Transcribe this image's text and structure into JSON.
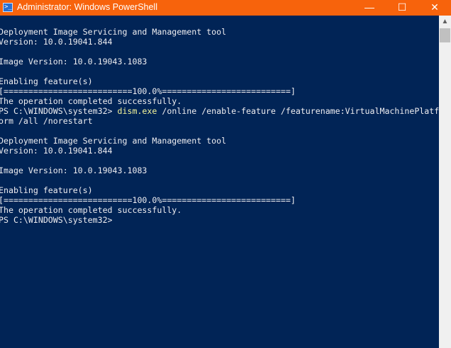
{
  "window": {
    "title": "Administrator: Windows PowerShell",
    "icon": "powershell-icon",
    "minimize": "—",
    "maximize": "☐",
    "close": "✕"
  },
  "console": {
    "lines": [
      {
        "text": "Deployment Image Servicing and Management tool"
      },
      {
        "text": "Version: 10.0.19041.844"
      },
      {
        "text": ""
      },
      {
        "text": "Image Version: 10.0.19043.1083"
      },
      {
        "text": ""
      },
      {
        "text": "Enabling feature(s)"
      },
      {
        "text": "[==========================100.0%==========================]"
      },
      {
        "text": "The operation completed successfully."
      },
      {
        "prompt": "PS C:\\WINDOWS\\system32> ",
        "command": "dism.exe",
        "args": " /online /enable-feature /featurename:VirtualMachinePlatf"
      },
      {
        "text": "orm /all /norestart"
      },
      {
        "text": ""
      },
      {
        "text": "Deployment Image Servicing and Management tool"
      },
      {
        "text": "Version: 10.0.19041.844"
      },
      {
        "text": ""
      },
      {
        "text": "Image Version: 10.0.19043.1083"
      },
      {
        "text": ""
      },
      {
        "text": "Enabling feature(s)"
      },
      {
        "text": "[==========================100.0%==========================]"
      },
      {
        "text": "The operation completed successfully."
      },
      {
        "prompt": "PS C:\\WINDOWS\\system32>"
      }
    ]
  },
  "colors": {
    "titlebar": "#f7630c",
    "background": "#012456",
    "text": "#eeedf0",
    "command": "#f5f59a"
  }
}
